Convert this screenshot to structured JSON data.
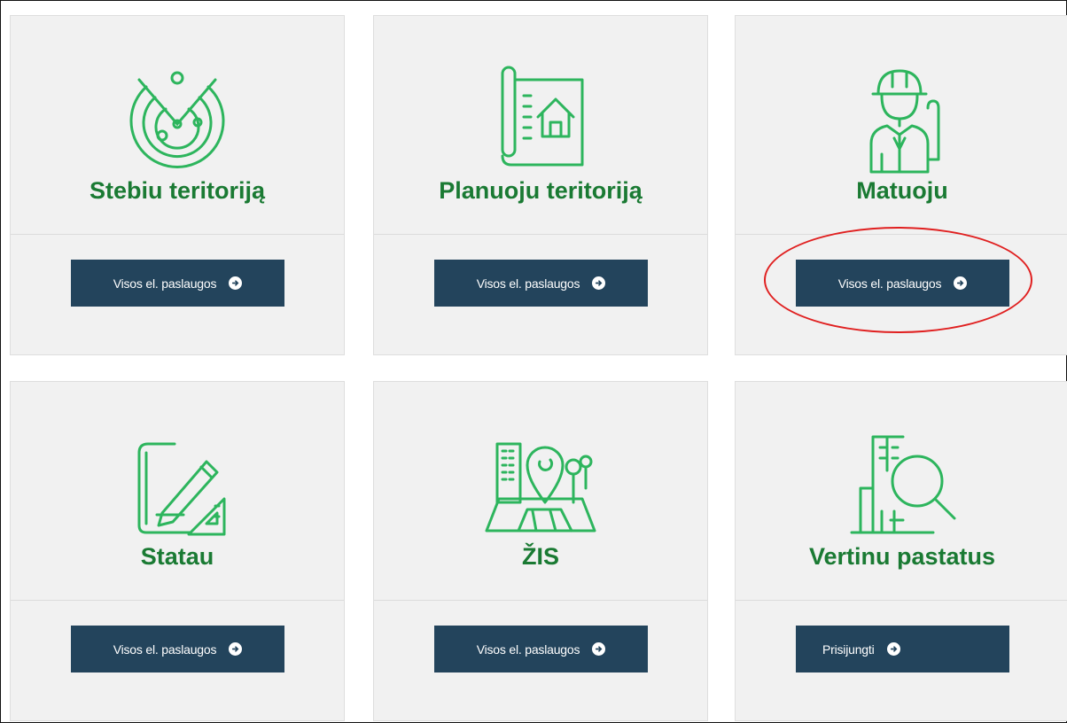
{
  "cards": [
    {
      "title": "Stebiu teritoriją",
      "icon": "radar-icon",
      "button": "Visos el. paslaugos"
    },
    {
      "title": "Planuoju teritoriją",
      "icon": "blueprint-house-icon",
      "button": "Visos el. paslaugos"
    },
    {
      "title": "Matuoju",
      "icon": "surveyor-worker-icon",
      "button": "Visos el. paslaugos"
    },
    {
      "title": "Statau",
      "icon": "drafting-pencil-icon",
      "button": "Visos el. paslaugos"
    },
    {
      "title": "ŽIS",
      "icon": "map-pin-city-icon",
      "button": "Visos el. paslaugos"
    },
    {
      "title": "Vertinu pastatus",
      "icon": "building-magnifier-icon",
      "button": "Prisijungti"
    }
  ],
  "colors": {
    "icon_green": "#2db55d",
    "title_green": "#1a7a33",
    "button_bg": "#23445c",
    "card_bg": "#f1f1f1",
    "highlight_red": "#e02020"
  }
}
